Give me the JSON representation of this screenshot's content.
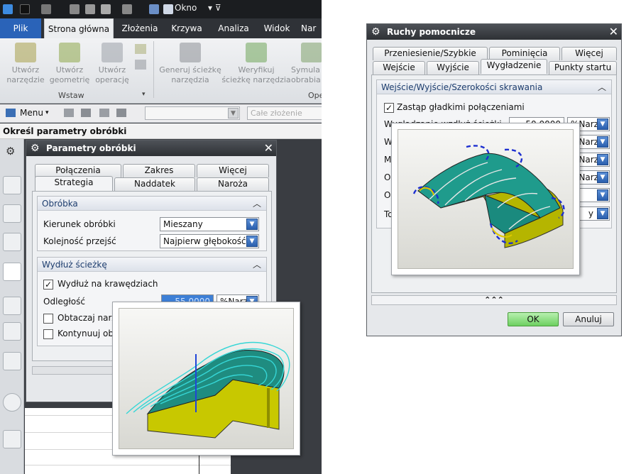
{
  "app": {
    "window_menu": "Okno",
    "tabs": [
      "Plik",
      "Strona główna",
      "Złożenia",
      "Krzywa",
      "Analiza",
      "Widok",
      "Nar"
    ],
    "ribbon_buttons": [
      {
        "line1": "Utwórz",
        "line2": "narzędzie"
      },
      {
        "line1": "Utwórz",
        "line2": "geometrię"
      },
      {
        "line1": "Utwórz",
        "line2": "operację"
      },
      {
        "line1": "Generuj ścieżkę",
        "line2": "narzędzia"
      },
      {
        "line1": "Weryfikuj",
        "line2": "ścieżkę narzędzia"
      },
      {
        "line1": "Symula",
        "line2": "obrabia"
      }
    ],
    "ribbon_groups": [
      "Wstaw",
      "Ope"
    ],
    "menu_label": "Menu",
    "assembly_placeholder": "Całe złożenie",
    "status_text": "Określ parametry obróbki"
  },
  "param_dialog": {
    "title": "Parametry obróbki",
    "tabs_row1": [
      "Połączenia",
      "Zakres",
      "Więcej"
    ],
    "tabs_row2": [
      "Strategia",
      "Naddatek",
      "Naroża"
    ],
    "sec_obrobka": "Obróbka",
    "kierunek_label": "Kierunek obróbki",
    "kierunek_value": "Mieszany",
    "kolejnosc_label": "Kolejność przejść",
    "kolejnosc_value": "Najpierw głębokość",
    "sec_wydluz": "Wydłuż ścieżkę",
    "wydluz_check": "Wydłuż na krawędziach",
    "odleglosc_label": "Odległość",
    "odleglosc_value": "55.0000",
    "odleglosc_unit": "%Narzę",
    "obtaczaj_label": "Obtaczaj narzę",
    "kontynuuj_label": "Kontynuuj obró"
  },
  "ruchy_dialog": {
    "title": "Ruchy pomocnicze",
    "tabs_row1": [
      "Przeniesienie/Szybkie",
      "Pominięcia",
      "Więcej"
    ],
    "tabs_row2": [
      "Wejście",
      "Wyjście",
      "Wygładzenie",
      "Punkty startu"
    ],
    "section": "Wejście/Wyjście/Szerokości skrawania",
    "zastap_label": "Zastąp gładkimi połączeniami",
    "row_labels": [
      "Wygładzanie wzdłuż ścieżki",
      "Wy",
      "Ma",
      "Od",
      "Od",
      "To"
    ],
    "row1_value": "50.0000",
    "units": [
      "%Narzę",
      "%Narzę",
      "%Narzę",
      "%Narzę",
      "",
      ""
    ],
    "row6_value": "y",
    "ok_label": "OK",
    "cancel_label": "Anuluj"
  }
}
